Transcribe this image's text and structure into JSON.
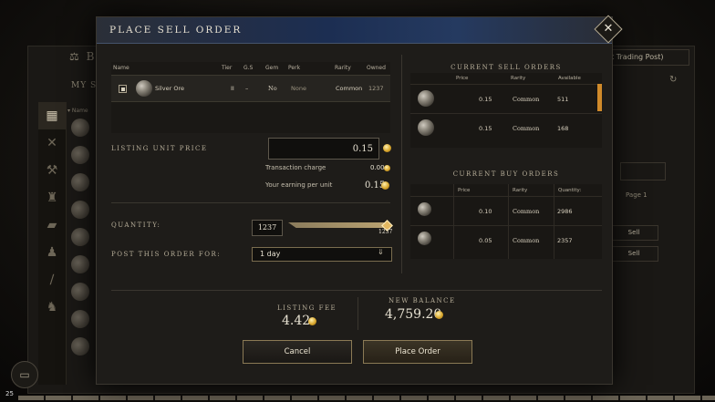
{
  "background": {
    "title": "BU",
    "subtitle": "MY SEL",
    "items_col": "Name",
    "trading_post": "rent Trading Post)",
    "page_label": "Page 1",
    "sell_label": "Sell",
    "level": "25"
  },
  "modal": {
    "title": "PLACE SELL ORDER",
    "table": {
      "headers": [
        "Name",
        "Tier",
        "G.S",
        "Gem",
        "Perk",
        "Rarity",
        "Owned"
      ],
      "row": {
        "name": "Silver Ore",
        "tier": "II",
        "gs": "–",
        "gem": "No",
        "perk": "None",
        "rarity": "Common",
        "owned": "1237"
      }
    },
    "listing_unit_price_label": "LISTING UNIT PRICE",
    "listing_unit_price": "0.15",
    "transaction_charge_label": "Transaction charge",
    "transaction_charge": "0.00",
    "earning_label": "Your earning per unit",
    "earning": "0.15",
    "quantity_label": "QUANTITY:",
    "quantity": "1237",
    "quantity_max": "1237",
    "quantity_fraction": 1.0,
    "post_label": "POST THIS ORDER FOR:",
    "post_duration": "1 day",
    "sell_orders": {
      "title": "CURRENT SELL ORDERS",
      "headers": [
        "Price",
        "Rarity",
        "Available"
      ],
      "rows": [
        {
          "price": "0.15",
          "rarity": "Common",
          "available": "511"
        },
        {
          "price": "0.15",
          "rarity": "Common",
          "available": "168"
        }
      ]
    },
    "buy_orders": {
      "title": "CURRENT BUY ORDERS",
      "headers": [
        "Price",
        "Rarity",
        "Quantity:"
      ],
      "rows": [
        {
          "price": "0.10",
          "rarity": "Common",
          "quantity": "2986"
        },
        {
          "price": "0.05",
          "rarity": "Common",
          "quantity": "2357"
        }
      ]
    },
    "listing_fee_label": "LISTING FEE",
    "listing_fee": "4.42",
    "new_balance_label": "NEW BALANCE",
    "new_balance": "4,759.20",
    "cancel_label": "Cancel",
    "place_label": "Place Order",
    "colors": {
      "header_blue": "#1c2e52",
      "accent_gold": "#d8a62c",
      "scroll_orange": "#d08a2a"
    }
  }
}
